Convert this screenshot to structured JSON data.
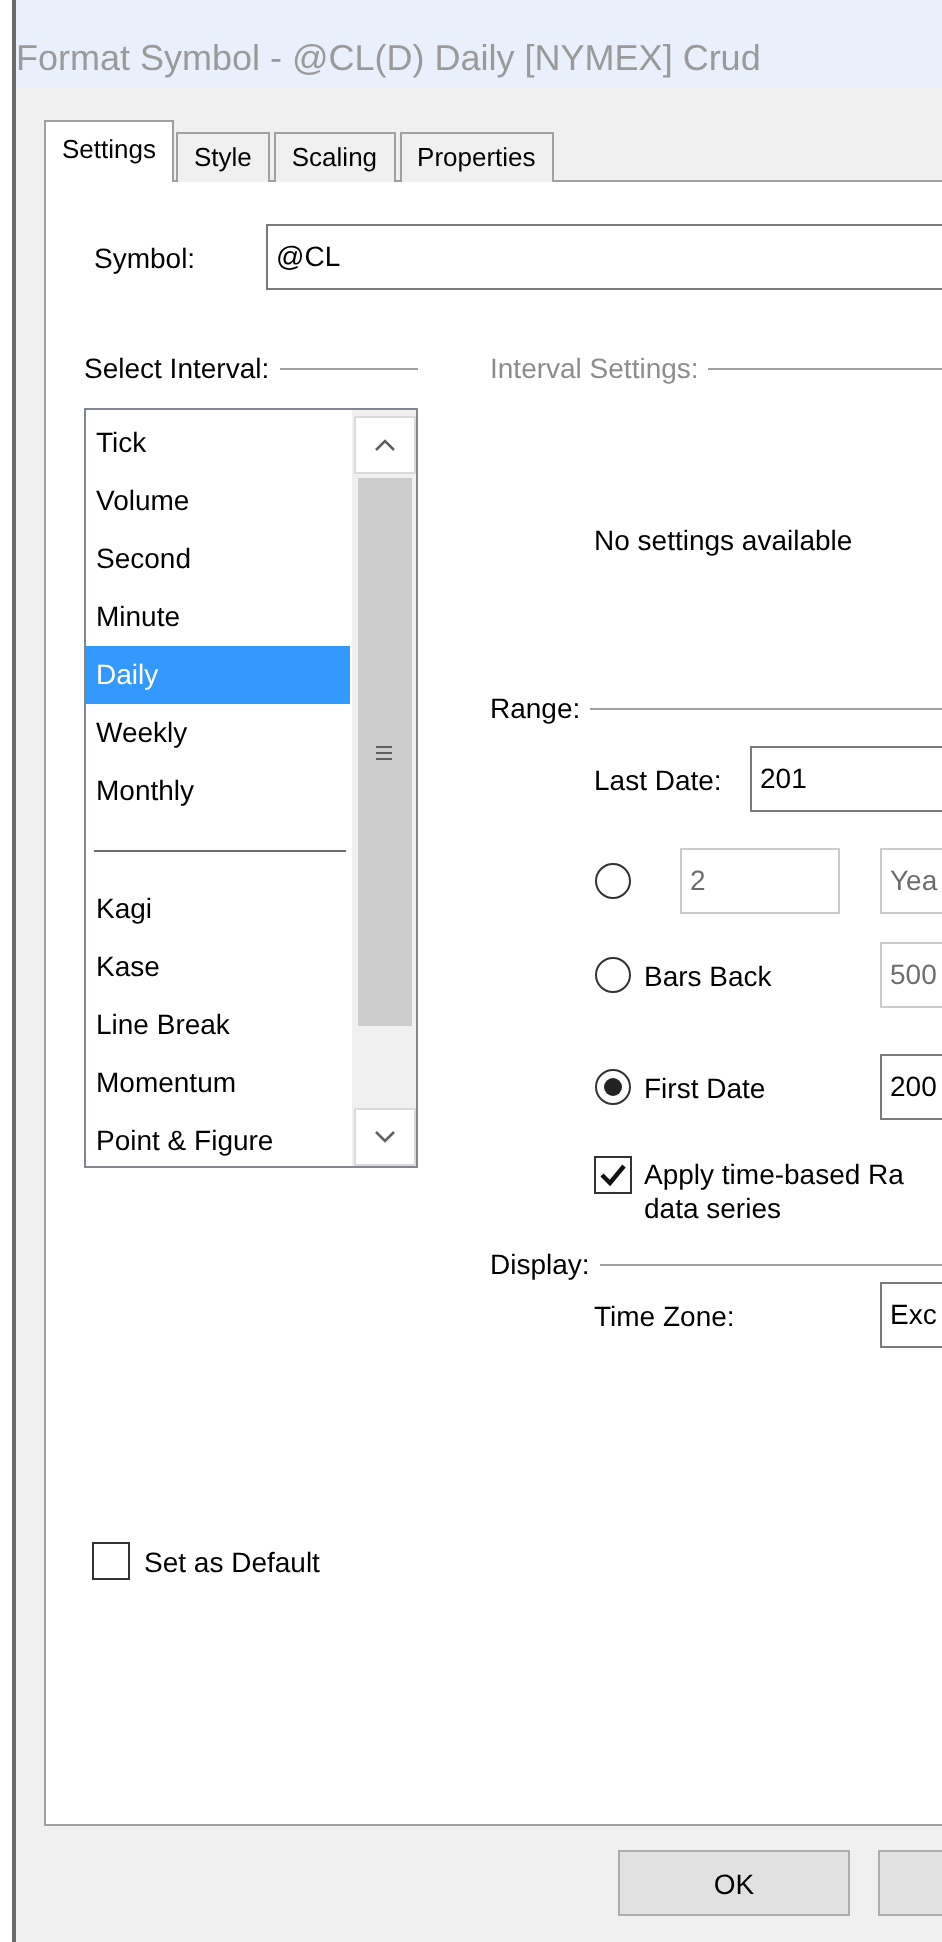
{
  "window": {
    "title": "Format Symbol - @CL(D) Daily [NYMEX] Crud"
  },
  "tabs": [
    {
      "label": "Settings",
      "selected": true
    },
    {
      "label": "Style",
      "selected": false
    },
    {
      "label": "Scaling",
      "selected": false
    },
    {
      "label": "Properties",
      "selected": false
    }
  ],
  "symbol": {
    "label": "Symbol:",
    "value": "@CL"
  },
  "select_interval": {
    "label": "Select Interval:",
    "groups": [
      {
        "items": [
          {
            "label": "Tick",
            "selected": false
          },
          {
            "label": "Volume",
            "selected": false
          },
          {
            "label": "Second",
            "selected": false
          },
          {
            "label": "Minute",
            "selected": false
          },
          {
            "label": "Daily",
            "selected": true
          },
          {
            "label": "Weekly",
            "selected": false
          },
          {
            "label": "Monthly",
            "selected": false
          }
        ]
      },
      {
        "items": [
          {
            "label": "Kagi",
            "selected": false
          },
          {
            "label": "Kase",
            "selected": false
          },
          {
            "label": "Line Break",
            "selected": false
          },
          {
            "label": "Momentum",
            "selected": false
          },
          {
            "label": "Point & Figure",
            "selected": false
          }
        ]
      }
    ]
  },
  "interval_settings": {
    "label": "Interval Settings:",
    "disabled": true,
    "message": "No settings available"
  },
  "range": {
    "label": "Range:",
    "last_date": {
      "label": "Last Date:",
      "value": "201",
      "disabled": false
    },
    "options": [
      {
        "selected": false,
        "fields": [
          {
            "value": "2",
            "disabled": true
          },
          {
            "value": "Yea",
            "disabled": true
          }
        ]
      },
      {
        "label": "Bars Back",
        "selected": false,
        "fields": [
          {
            "value": "500",
            "disabled": true
          }
        ]
      },
      {
        "label": "First Date",
        "selected": true,
        "fields": [
          {
            "value": "200",
            "disabled": false
          }
        ]
      }
    ],
    "apply_time_based": {
      "checked": true,
      "lines": [
        "Apply time-based Ra",
        "data series"
      ]
    }
  },
  "display": {
    "label": "Display:",
    "time_zone": {
      "label": "Time Zone:",
      "value": "Exc",
      "disabled": false
    }
  },
  "set_as_default": {
    "label": "Set as Default",
    "checked": false
  },
  "buttons": [
    {
      "kind": "labeled",
      "label": "OK"
    },
    {
      "kind": "cut_off"
    }
  ]
}
